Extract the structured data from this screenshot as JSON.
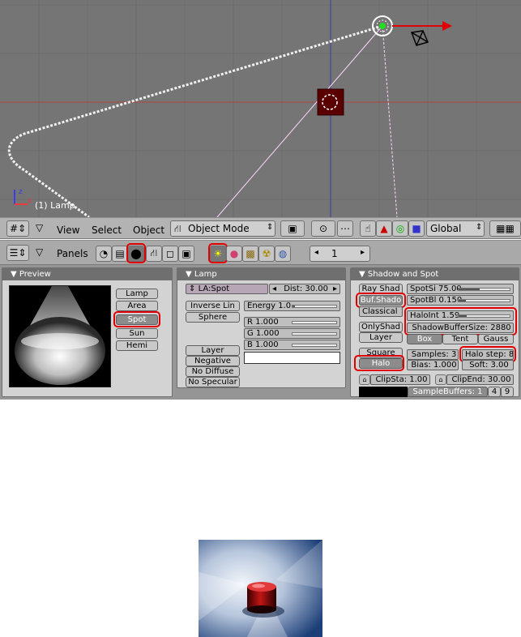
{
  "viewport": {
    "caption": "(1) Lamp",
    "axis_z": "z",
    "axis_x": "x"
  },
  "header3d": {
    "menu": [
      "View",
      "Select",
      "Object"
    ],
    "mode": "Object Mode",
    "orientation": "Global"
  },
  "buttons_header": {
    "panels_label": "Panels",
    "frame": "1"
  },
  "preview_panel": {
    "title": "Preview",
    "types": [
      "Lamp",
      "Area",
      "Spot",
      "Sun",
      "Hemi"
    ],
    "selected": "Spot"
  },
  "lamp_panel": {
    "title": "Lamp",
    "name": "LA:Spot",
    "dist": "Dist: 30.00",
    "inverse": "Inverse Lin",
    "sphere": "Sphere",
    "energy": "Energy 1.0",
    "r": "R 1.000",
    "g": "G 1.000",
    "b": "B 1.000",
    "layer": "Layer",
    "negative": "Negative",
    "no_diffuse": "No Diffuse",
    "no_specular": "No Specular",
    "energy_level": 0.05,
    "color_level": 1.0
  },
  "shadow_panel": {
    "title": "Shadow and Spot",
    "ray_shad": "Ray Shad",
    "buf_shad": "Buf.Shado",
    "classical": "Classical",
    "only_shad": "OnlyShad",
    "layer": "Layer",
    "square": "Square",
    "halo": "Halo",
    "spot_si": "SpotSi 75.00",
    "spot_bl": "SpotBl 0.150",
    "halo_int": "HaloInt 1.59",
    "shadow_buffer_size": "ShadowBufferSize: 2880",
    "box": "Box",
    "tent": "Tent",
    "gauss": "Gauss",
    "samples": "Samples: 3",
    "halo_step": "Halo step: 8",
    "bias": "Bias: 1.000",
    "soft": "Soft: 3.00",
    "clip_sta": "ClipSta: 1.00",
    "clip_end": "ClipEnd: 30.00",
    "sample_buffers": "SampleBuffers: 1",
    "sb4": "4",
    "sb9": "9",
    "spot_si_level": 0.41,
    "spot_bl_level": 0.15,
    "halo_int_level": 0.16
  },
  "colors": {
    "viewport_bg": "#757575",
    "highlight_red": "#e00000",
    "grid_red": "#b04545",
    "grid_blue": "#3a3aa0"
  }
}
